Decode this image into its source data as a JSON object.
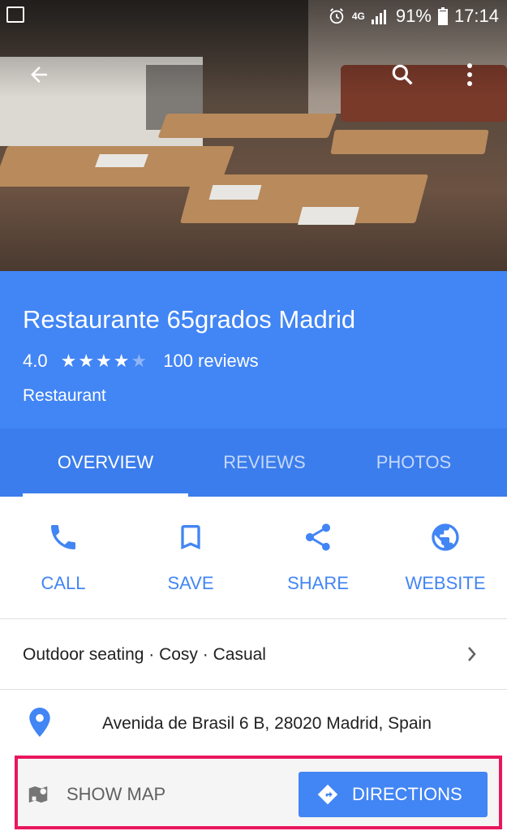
{
  "status_bar": {
    "network": "4G",
    "battery": "91%",
    "time": "17:14"
  },
  "place": {
    "name": "Restaurante 65grados Madrid",
    "rating": "4.0",
    "stars": "★★★★",
    "star_empty": "★",
    "rating_value": 4.0,
    "reviews": "100 reviews",
    "category": "Restaurant"
  },
  "tabs": [
    {
      "label": "OVERVIEW",
      "active": true
    },
    {
      "label": "REVIEWS",
      "active": false
    },
    {
      "label": "PHOTOS",
      "active": false
    }
  ],
  "actions": [
    {
      "label": "CALL",
      "icon": "phone-icon"
    },
    {
      "label": "SAVE",
      "icon": "bookmark-icon"
    },
    {
      "label": "SHARE",
      "icon": "share-icon"
    },
    {
      "label": "WEBSITE",
      "icon": "globe-icon"
    }
  ],
  "tags": "Outdoor seating · Cosy · Casual",
  "address": "Avenida de Brasil 6 B, 28020 Madrid, Spain",
  "bottom_bar": {
    "show_map": "SHOW MAP",
    "directions": "DIRECTIONS"
  },
  "colors": {
    "primary": "#4285f4",
    "tab_bar": "#3b7ded",
    "highlight_border": "#e8175d"
  }
}
